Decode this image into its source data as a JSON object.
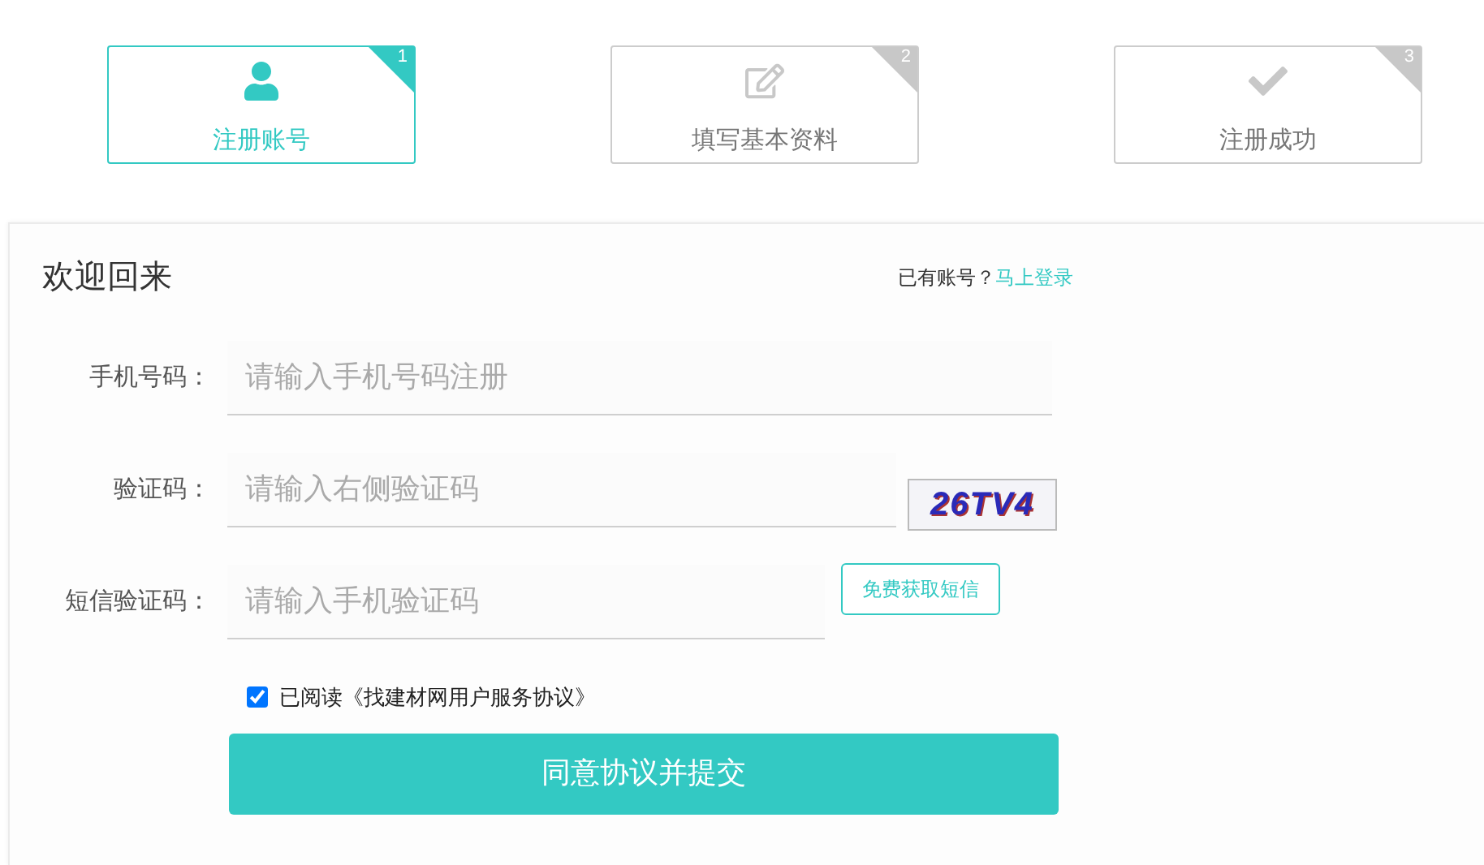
{
  "steps": [
    {
      "number": "1",
      "label": "注册账号",
      "kind": "account",
      "selected": true
    },
    {
      "number": "2",
      "label": "填写基本资料",
      "kind": "profile",
      "selected": false
    },
    {
      "number": "3",
      "label": "注册成功",
      "kind": "done",
      "selected": false
    }
  ],
  "panel": {
    "title": "欢迎回来",
    "login_prompt": "已有账号？",
    "login_link": "马上登录"
  },
  "fields": [
    {
      "kind": "plain",
      "label": "手机号码：",
      "placeholder": "请输入手机号码注册"
    },
    {
      "kind": "captcha",
      "label": "验证码：",
      "placeholder": "请输入右侧验证码",
      "captcha": "26TV4"
    },
    {
      "kind": "sms",
      "label": "短信验证码：",
      "placeholder": "请输入手机验证码",
      "button": "免费获取短信"
    }
  ],
  "agreement": {
    "checked": true,
    "text": "已阅读《找建材网用户服务协议》"
  },
  "submit": "同意协议并提交"
}
